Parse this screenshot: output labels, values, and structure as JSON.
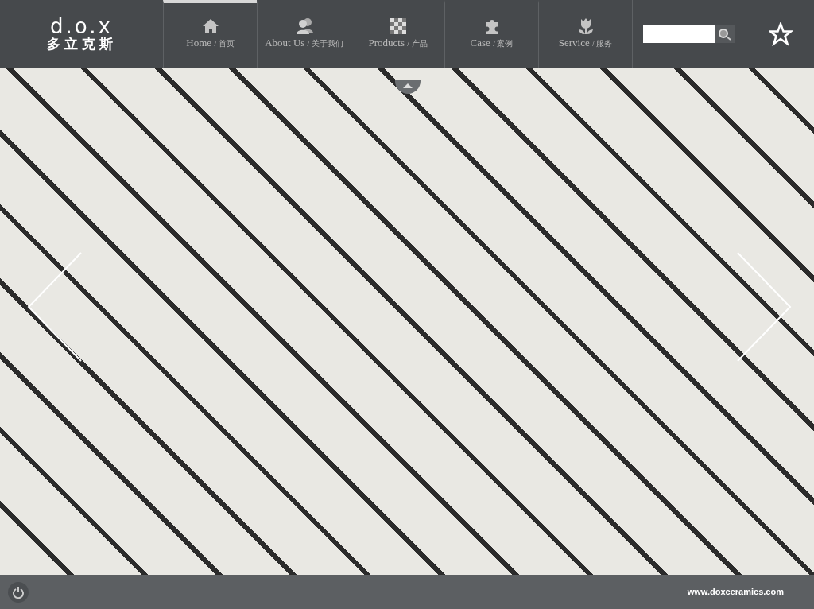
{
  "logo": {
    "wordmark": "d.o.x",
    "name_cn": "多立克斯"
  },
  "nav": [
    {
      "label": "Home",
      "label_cn": "/ 首页",
      "kind": "house",
      "selected": true
    },
    {
      "label": "About Us",
      "label_cn": "/ 关于我们",
      "kind": "people",
      "selected": false
    },
    {
      "label": "Products",
      "label_cn": "/ 产品",
      "kind": "grid",
      "selected": false
    },
    {
      "label": "Case",
      "label_cn": "/ 案例",
      "kind": "puzzle",
      "selected": false
    },
    {
      "label": "Service",
      "label_cn": "/ 服务",
      "kind": "tulip",
      "selected": false
    }
  ],
  "footer": {
    "url": "www.doxceramics.com"
  }
}
